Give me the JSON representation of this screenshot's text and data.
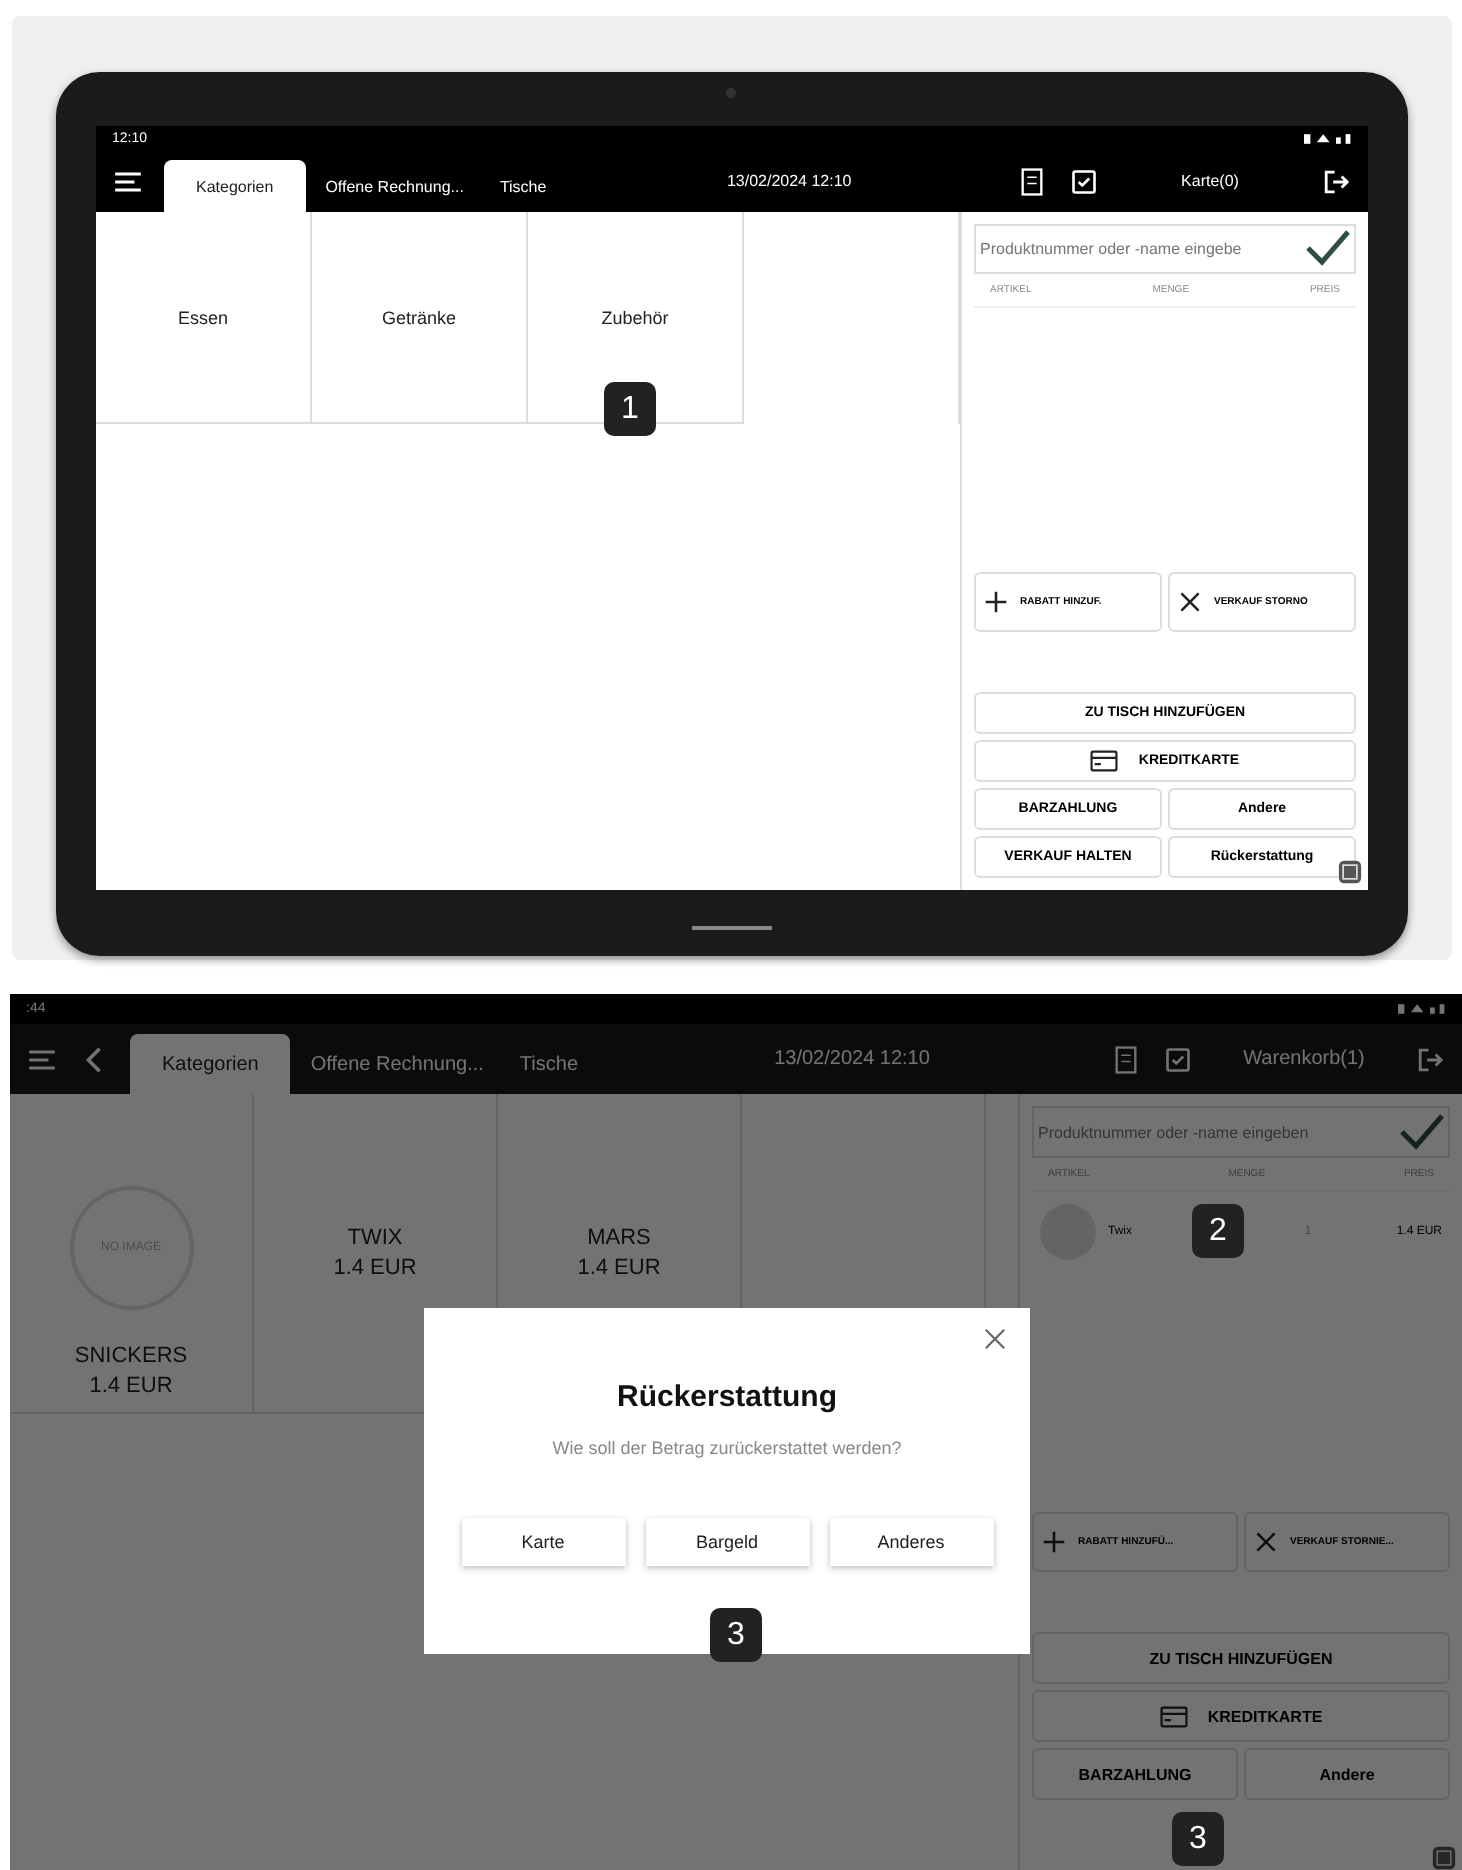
{
  "screenshots": [
    {
      "kind": "tablet",
      "status_bar": {
        "time": "12:10"
      },
      "tabs": [
        {
          "label": "Kategorien",
          "selected": true
        },
        {
          "label": "Offene Rechnung...",
          "selected": false
        },
        {
          "label": "Tische",
          "selected": false
        }
      ],
      "datetime": "13/02/2024 12:10",
      "cart_label": "Karte(0)",
      "tiles_callout": "1",
      "tiles": [
        {
          "kind": "category",
          "name": "Essen"
        },
        {
          "kind": "category",
          "name": "Getränke"
        },
        {
          "kind": "category",
          "name": "Zubehör"
        }
      ],
      "search": {
        "placeholder": "Produktnummer oder -name eingebe"
      },
      "columns": [
        "ARTIKEL",
        "MENGE",
        "PREIS"
      ],
      "actions": [
        {
          "kind": "plus",
          "label": "RABATT HINZUF."
        },
        {
          "kind": "cross",
          "label": "VERKAUF STORNO"
        }
      ],
      "payment_buttons": [
        {
          "kind": "wide",
          "label": "ZU TISCH HINZUFÜGEN"
        },
        {
          "kind": "card",
          "label": "KREDITKARTE"
        },
        {
          "kind": "half",
          "label": "BARZAHLUNG"
        },
        {
          "kind": "half",
          "label": "Andere"
        },
        {
          "kind": "half",
          "label": "VERKAUF HALTEN"
        },
        {
          "kind": "half",
          "label": "Rückerstattung"
        }
      ]
    },
    {
      "kind": "plain",
      "status_bar": {
        "time": ":44"
      },
      "back_button": true,
      "tabs": [
        {
          "label": "Kategorien",
          "selected": true
        },
        {
          "label": "Offene Rechnung...",
          "selected": false
        },
        {
          "label": "Tische",
          "selected": false
        }
      ],
      "datetime": "13/02/2024 12:10",
      "cart_label": "Warenkorb(1)",
      "tiles": [
        {
          "kind": "product",
          "name": "SNICKERS",
          "price": "1.4 EUR",
          "image_label": "NO IMAGE"
        },
        {
          "kind": "product",
          "name": "TWIX",
          "price": "1.4 EUR"
        },
        {
          "kind": "product",
          "name": "MARS",
          "price": "1.4 EUR"
        }
      ],
      "search": {
        "placeholder": "Produktnummer oder -name eingeben"
      },
      "columns": [
        "ARTIKEL",
        "MENGE",
        "PREIS"
      ],
      "cart_items": [
        {
          "name": "Twix",
          "quantity": "1",
          "price": "1.4 EUR",
          "callout": "2"
        }
      ],
      "actions": [
        {
          "kind": "plus",
          "label": "RABATT HINZUFÜ..."
        },
        {
          "kind": "cross",
          "label": "VERKAUF STORNIE..."
        }
      ],
      "payment_buttons": [
        {
          "kind": "wide",
          "label": "ZU TISCH HINZUFÜGEN"
        },
        {
          "kind": "card",
          "label": "KREDITKARTE"
        },
        {
          "kind": "half",
          "label": "BARZAHLUNG"
        },
        {
          "kind": "half",
          "label": "Andere"
        }
      ],
      "payment_callout": "3",
      "dialog": {
        "title": "Rückerstattung",
        "message": "Wie soll der Betrag zurückerstattet werden?",
        "buttons": [
          "Karte",
          "Bargeld",
          "Anderes"
        ],
        "callout": "3"
      }
    }
  ]
}
